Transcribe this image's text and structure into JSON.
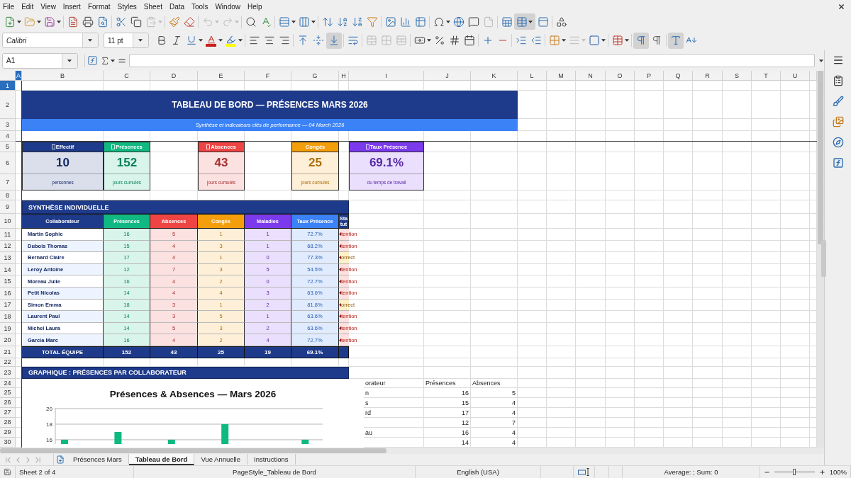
{
  "menu_bar": {
    "items": [
      "File",
      "Edit",
      "View",
      "Insert",
      "Format",
      "Styles",
      "Sheet",
      "Data",
      "Tools",
      "Window",
      "Help"
    ]
  },
  "standard_toolbar": {
    "freeze": {
      "on": true
    }
  },
  "formatting_toolbar": {
    "font_name": "Calibri",
    "font_size": "11 pt",
    "vertical_align": [
      {
        "selected": false
      },
      {
        "selected": false
      },
      {
        "selected": true
      }
    ],
    "paragraph_direction": [
      {
        "selected": true
      },
      {
        "selected": false
      }
    ],
    "text_direction": [
      {
        "selected": true
      },
      {
        "selected": false
      }
    ]
  },
  "formula_bar": {
    "name_box": "A1"
  },
  "sheet": {
    "columns": [
      {
        "label": "A",
        "selected": true
      },
      {
        "label": "B",
        "selected": false
      },
      {
        "label": "C",
        "selected": false
      },
      {
        "label": "D",
        "selected": false
      },
      {
        "label": "E",
        "selected": false
      },
      {
        "label": "F",
        "selected": false
      },
      {
        "label": "G",
        "selected": false
      },
      {
        "label": "H",
        "selected": false
      },
      {
        "label": "I",
        "selected": false
      },
      {
        "label": "J",
        "selected": false
      },
      {
        "label": "K",
        "selected": false
      },
      {
        "label": "L",
        "selected": false
      },
      {
        "label": "M",
        "selected": false
      },
      {
        "label": "N",
        "selected": false
      },
      {
        "label": "O",
        "selected": false
      },
      {
        "label": "P",
        "selected": false
      },
      {
        "label": "Q",
        "selected": false
      },
      {
        "label": "R",
        "selected": false
      },
      {
        "label": "S",
        "selected": false
      },
      {
        "label": "T",
        "selected": false
      },
      {
        "label": "U",
        "selected": false
      }
    ],
    "rows": [
      {
        "label": "1",
        "selected": true
      },
      {
        "label": "2",
        "selected": false
      },
      {
        "label": "3",
        "selected": false
      },
      {
        "label": "4",
        "selected": false
      },
      {
        "label": "5",
        "selected": false
      },
      {
        "label": "6",
        "selected": false
      },
      {
        "label": "7",
        "selected": false
      },
      {
        "label": "8",
        "selected": false
      },
      {
        "label": "9",
        "selected": false
      },
      {
        "label": "10",
        "selected": false
      },
      {
        "label": "11",
        "selected": false
      },
      {
        "label": "12",
        "selected": false
      },
      {
        "label": "13",
        "selected": false
      },
      {
        "label": "14",
        "selected": false
      },
      {
        "label": "15",
        "selected": false
      },
      {
        "label": "16",
        "selected": false
      },
      {
        "label": "17",
        "selected": false
      },
      {
        "label": "18",
        "selected": false
      },
      {
        "label": "19",
        "selected": false
      },
      {
        "label": "20",
        "selected": false
      },
      {
        "label": "21",
        "selected": false
      },
      {
        "label": "22",
        "selected": false
      },
      {
        "label": "23",
        "selected": false
      },
      {
        "label": "24",
        "selected": false
      },
      {
        "label": "25",
        "selected": false
      },
      {
        "label": "26",
        "selected": false
      },
      {
        "label": "27",
        "selected": false
      },
      {
        "label": "28",
        "selected": false
      },
      {
        "label": "29",
        "selected": false
      },
      {
        "label": "30",
        "selected": false
      }
    ],
    "title": "TABLEAU DE BORD — PRÉSENCES MARS 2026",
    "subtitle": "Synthèse et indicateurs clés de performance — 04 March 2026",
    "kpi_cards": [
      {
        "label": "Effectif",
        "glyph_missing": true,
        "value": "10",
        "caption": "personnes",
        "color": "#1e3a8a"
      },
      {
        "label": "Présences",
        "glyph_missing": true,
        "value": "152",
        "caption": "jours cumulés",
        "color": "#10b981"
      },
      {
        "label": "Absences",
        "glyph_missing": true,
        "value": "43",
        "caption": "jours cumulés",
        "color": "#ef4444"
      },
      {
        "label": "Congés",
        "glyph_missing": false,
        "value": "25",
        "caption": "jours cumulés",
        "color": "#f59e0b"
      },
      {
        "label": "Taux Présence",
        "glyph_missing": true,
        "value": "69.1%",
        "caption": "du temps de travail",
        "color": "#7c3aed"
      }
    ],
    "summary_table": {
      "title": "SYNTHÈSE INDIVIDUELLE",
      "columns": [
        {
          "label": "Collaborateur",
          "color": "#1e3a8a"
        },
        {
          "label": "Présences",
          "color": "#10b981"
        },
        {
          "label": "Absences",
          "color": "#ef4444"
        },
        {
          "label": "Congés",
          "color": "#f59e0b"
        },
        {
          "label": "Maladies",
          "color": "#7c3aed"
        },
        {
          "label": "Taux Présence",
          "color": "#3b82f6"
        },
        {
          "label": "Statut",
          "color": "#1e3a8a"
        }
      ],
      "rows": [
        {
          "cells": [
            "Martin Sophie",
            "16",
            "5",
            "1",
            "1",
            "72.7%"
          ],
          "status": {
            "text": "tention",
            "kind": "attention"
          }
        },
        {
          "cells": [
            "Dubois Thomas",
            "15",
            "4",
            "3",
            "1",
            "68.2%"
          ],
          "status": {
            "text": "tention",
            "kind": "attention"
          }
        },
        {
          "cells": [
            "Bernard Claire",
            "17",
            "4",
            "1",
            "0",
            "77.3%"
          ],
          "status": {
            "text": "orrect",
            "kind": "correct"
          }
        },
        {
          "cells": [
            "Leroy Antoine",
            "12",
            "7",
            "3",
            "5",
            "54.5%"
          ],
          "status": {
            "text": "tention",
            "kind": "attention"
          }
        },
        {
          "cells": [
            "Moreau Julie",
            "16",
            "4",
            "2",
            "0",
            "72.7%"
          ],
          "status": {
            "text": "tention",
            "kind": "attention"
          }
        },
        {
          "cells": [
            "Petit Nicolas",
            "14",
            "4",
            "4",
            "3",
            "63.6%"
          ],
          "status": {
            "text": "tention",
            "kind": "attention"
          }
        },
        {
          "cells": [
            "Simon Emma",
            "18",
            "3",
            "1",
            "2",
            "81.8%"
          ],
          "status": {
            "text": "orrect",
            "kind": "correct"
          }
        },
        {
          "cells": [
            "Laurent Paul",
            "14",
            "3",
            "5",
            "1",
            "63.6%"
          ],
          "status": {
            "text": "tention",
            "kind": "attention"
          }
        },
        {
          "cells": [
            "Michel Laura",
            "14",
            "5",
            "3",
            "2",
            "63.6%"
          ],
          "status": {
            "text": "tention",
            "kind": "attention"
          }
        },
        {
          "cells": [
            "Garcia Marc",
            "16",
            "4",
            "2",
            "4",
            "72.7%"
          ],
          "status": {
            "text": "tention",
            "kind": "attention"
          }
        }
      ],
      "total": [
        "TOTAL ÉQUIPE",
        "152",
        "43",
        "25",
        "19",
        "69.1%"
      ]
    },
    "chart_section": {
      "title": "GRAPHIQUE : PRÉSENCES PAR COLLABORATEUR",
      "chart_data": {
        "type": "bar",
        "title": "Présences & Absences — Mars 2026",
        "ylim": [
          15.45,
          20
        ],
        "yticks": [
          16,
          18,
          20
        ],
        "series": [
          {
            "color": "#10b981",
            "values": [
              16,
              null,
              17,
              null,
              16,
              null,
              18,
              null,
              null,
              16
            ]
          }
        ]
      }
    },
    "data_range": {
      "headings": [
        "orateur",
        "Présences",
        "Absences"
      ],
      "rows": [
        [
          "n",
          "16",
          "5"
        ],
        [
          "s",
          "15",
          "4"
        ],
        [
          "rd",
          "17",
          "4"
        ],
        [
          null,
          "12",
          "7"
        ],
        [
          "au",
          "16",
          "4"
        ],
        [
          null,
          "14",
          "4"
        ]
      ]
    }
  },
  "sheet_tabs": [
    {
      "label": "Présences Mars",
      "selected": false
    },
    {
      "label": "Tableau de Bord",
      "selected": true
    },
    {
      "label": "Vue Annuelle",
      "selected": false
    },
    {
      "label": "Instructions",
      "selected": false
    }
  ],
  "status_bar": {
    "sheet": "Sheet 2 of 4",
    "page_style": "PageStyle_Tableau de Bord",
    "language": "English (USA)",
    "selection_summary": "Average: ; Sum: 0",
    "zoom": {
      "level": 0.5,
      "reading": "100%"
    }
  }
}
